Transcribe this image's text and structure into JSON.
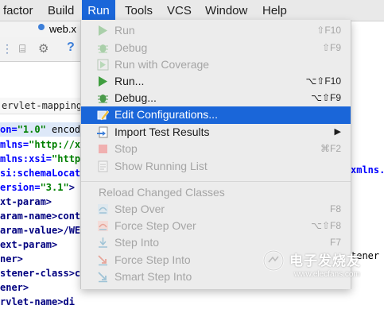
{
  "menubar": {
    "items": [
      "factor",
      "Build",
      "Run",
      "Tools",
      "VCS",
      "Window",
      "Help"
    ],
    "active": "Run"
  },
  "editor": {
    "tab_label": "web.x",
    "crumb": "ervlet-mapping",
    "lines": [
      {
        "a": "on=",
        "b": "\"1.0\"",
        "c": " encod"
      },
      {
        "a": "mlns=",
        "b": "\"http://xm",
        "c": ""
      },
      {
        "a": "mlns:xsi=",
        "b": "\"http:",
        "c": ""
      },
      {
        "a": "si:schemaLocati",
        "b": "",
        "c": ""
      },
      {
        "a": "ersion=",
        "b": "\"3.1\"",
        "c": ">"
      },
      {
        "a": "xt-param>",
        "b": "",
        "c": ""
      },
      {
        "a": "aram-name>conte",
        "b": "",
        "c": ""
      },
      {
        "a": "aram-value>/WEB",
        "b": "",
        "c": ""
      },
      {
        "a": "ext-param>",
        "b": "",
        "c": ""
      },
      {
        "a": "ner>",
        "b": "",
        "c": ""
      },
      {
        "a": "stener-class>c",
        "b": "",
        "c": ""
      },
      {
        "a": "ener>",
        "b": "",
        "c": ""
      },
      {
        "a": "rvlet-name>di",
        "b": "",
        "c": ""
      }
    ],
    "right_fragments": [
      "xmlns.",
      "tener"
    ]
  },
  "run_menu": {
    "items": [
      {
        "label": "Run",
        "shortcut": "⇧F10",
        "enabled": false,
        "icon": "run-icon"
      },
      {
        "label": "Debug",
        "shortcut": "⇧F9",
        "enabled": false,
        "icon": "debug-icon"
      },
      {
        "label": "Run with Coverage",
        "shortcut": "",
        "enabled": false,
        "icon": "coverage-icon"
      },
      {
        "label": "Run...",
        "shortcut": "⌥⇧F10",
        "enabled": true,
        "icon": "run-icon"
      },
      {
        "label": "Debug...",
        "shortcut": "⌥⇧F9",
        "enabled": true,
        "icon": "debug-icon"
      },
      {
        "label": "Edit Configurations...",
        "shortcut": "",
        "enabled": true,
        "selected": true,
        "icon": "edit-config-icon"
      },
      {
        "label": "Import Test Results",
        "shortcut": "▶",
        "enabled": true,
        "icon": "import-icon"
      },
      {
        "label": "Stop",
        "shortcut": "⌘F2",
        "enabled": false,
        "icon": "stop-icon"
      },
      {
        "label": "Show Running List",
        "shortcut": "",
        "enabled": false,
        "icon": "list-icon"
      }
    ],
    "section_header": "Reload Changed Classes",
    "debug_items": [
      {
        "label": "Step Over",
        "shortcut": "F8",
        "icon": "step-over-icon"
      },
      {
        "label": "Force Step Over",
        "shortcut": "⌥⇧F8",
        "icon": "force-step-over-icon"
      },
      {
        "label": "Step Into",
        "shortcut": "F7",
        "icon": "step-into-icon"
      },
      {
        "label": "Force Step Into",
        "shortcut": "",
        "icon": "force-step-into-icon"
      },
      {
        "label": "Smart Step Into",
        "shortcut": "",
        "icon": "smart-step-into-icon"
      }
    ]
  },
  "watermark": {
    "text": "电子发烧友",
    "url": "www.elecfans.com"
  },
  "colors": {
    "menu_selection": "#1a66d9",
    "run_green": "#3f9e3f",
    "disabled": "#a5a5a5"
  }
}
